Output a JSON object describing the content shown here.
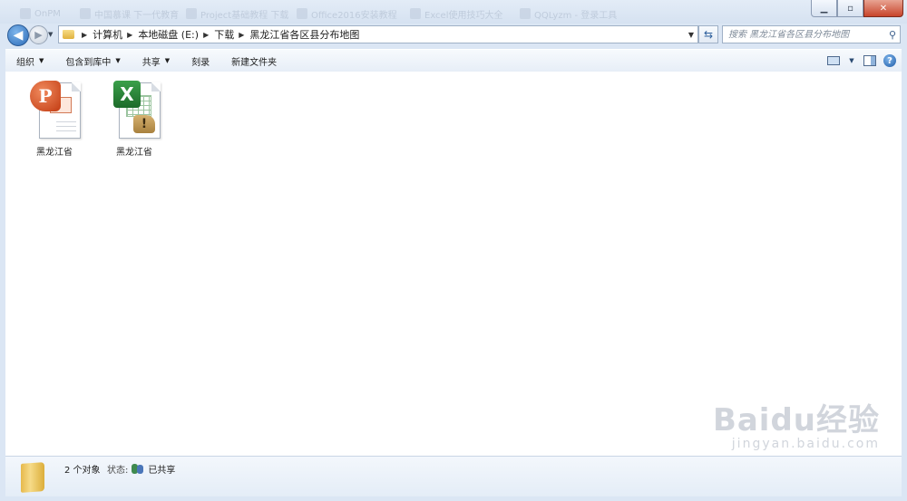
{
  "taskbar_ghost_tabs": [
    "OnPM",
    "中国慕课 下一代教育",
    "Project基础教程 下载",
    "Office2016安装教程",
    "Excel使用技巧大全",
    "QQLyzm - 登录工具"
  ],
  "window_controls": {
    "minimize": "▁",
    "maximize": "▫",
    "close": "✕"
  },
  "breadcrumb": [
    "计算机",
    "本地磁盘 (E:)",
    "下载",
    "黑龙江省各区县分布地图"
  ],
  "search": {
    "placeholder": "搜索 黑龙江省各区县分布地图"
  },
  "toolbar": {
    "organize": "组织",
    "include_in_library": "包含到库中",
    "share": "共享",
    "burn": "刻录",
    "new_folder": "新建文件夹",
    "help": "?"
  },
  "files": [
    {
      "name": "黑龙江省",
      "type": "powerpoint",
      "icon_letter": "P"
    },
    {
      "name": "黑龙江省",
      "type": "excel",
      "icon_letter": "X"
    }
  ],
  "status": {
    "count": "2 个对象",
    "state_label": "状态:",
    "state_value": "已共享"
  },
  "watermark": {
    "logo": "Baidu经验",
    "url": "jingyan.baidu.com"
  },
  "colors": {
    "window_chrome": "#dbe6f4",
    "close_button": "#c8442a",
    "ppt": "#c23b12",
    "excel": "#1d6b2a"
  }
}
